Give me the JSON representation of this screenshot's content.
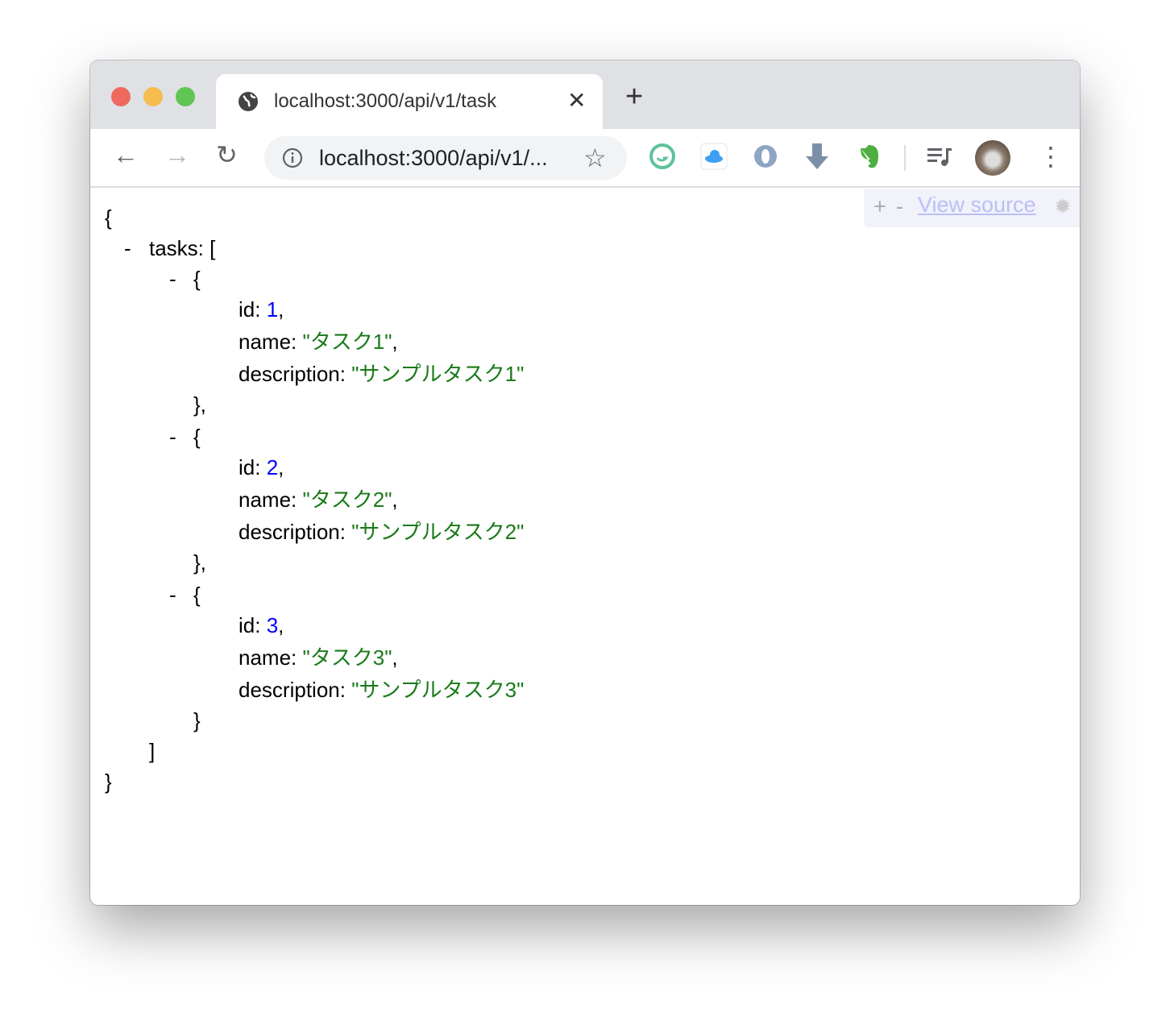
{
  "tab": {
    "title": "localhost:3000/api/v1/tasks/display",
    "close": "✕",
    "new_tab": "+"
  },
  "toolbar": {
    "url": "localhost:3000/api/v1/...",
    "back": "←",
    "forward": "→",
    "reload": "↻",
    "star": "☆",
    "menu": "⋮"
  },
  "extensions": [
    "grammarly-icon",
    "icloud-icon",
    "jsonview-icon",
    "download-icon",
    "evernote-icon",
    "media-control-icon"
  ],
  "viewer": {
    "plus": "+",
    "minus": "-",
    "view_source": "View source"
  },
  "json": {
    "open": "{",
    "close": "}",
    "toggle": "-",
    "tasks_key": "tasks:",
    "arr_open": "[",
    "arr_close": "]",
    "obj_open": "{",
    "obj_close_comma": "},",
    "obj_close": "}",
    "id_key": "id:",
    "name_key": "name:",
    "desc_key": "description:",
    "comma": ",",
    "tasks": [
      {
        "id": "1",
        "name": "\"タスク1\"",
        "description": "\"サンプルタスク1\""
      },
      {
        "id": "2",
        "name": "\"タスク2\"",
        "description": "\"サンプルタスク2\""
      },
      {
        "id": "3",
        "name": "\"タスク3\"",
        "description": "\"サンプルタスク3\""
      }
    ]
  }
}
